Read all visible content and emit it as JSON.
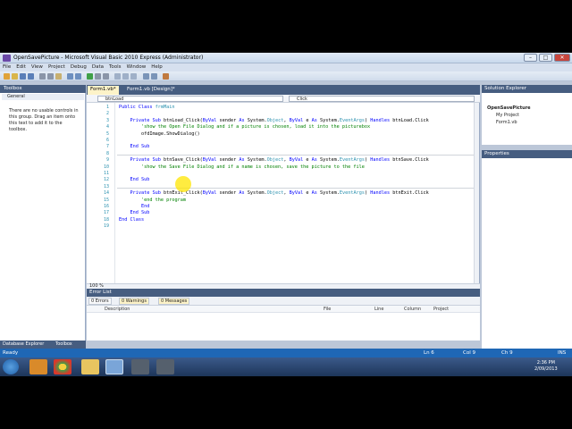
{
  "window": {
    "title": "OpenSavePicture - Microsoft Visual Basic 2010 Express (Administrator)",
    "min": "–",
    "max": "□",
    "close": "✕"
  },
  "menu": [
    "File",
    "Edit",
    "View",
    "Project",
    "Debug",
    "Data",
    "Tools",
    "Window",
    "Help"
  ],
  "toolbox": {
    "title": "Toolbox",
    "group": "General",
    "empty_text": "There are no usable controls in this group. Drag an item onto this text to add it to the toolbox.",
    "tabs": [
      "Database Explorer",
      "Toolbox"
    ]
  },
  "doc_tabs": [
    "Form1.vb*",
    "Form1.vb [Design]*"
  ],
  "navbar": {
    "object": "btnLoad",
    "member": "Click"
  },
  "code_lines": [
    {
      "n": "1",
      "segs": [
        {
          "t": "Public Class ",
          "c": "kw"
        },
        {
          "t": "frmMain",
          "c": "ty"
        }
      ]
    },
    {
      "n": "2",
      "segs": []
    },
    {
      "n": "3",
      "segs": [
        {
          "t": "    Private Sub ",
          "c": "kw"
        },
        {
          "t": "btnLoad_Click(",
          "c": ""
        },
        {
          "t": "ByVal ",
          "c": "kw"
        },
        {
          "t": "sender ",
          "c": ""
        },
        {
          "t": "As ",
          "c": "kw"
        },
        {
          "t": "System.",
          "c": ""
        },
        {
          "t": "Object",
          "c": "ty"
        },
        {
          "t": ", ",
          "c": ""
        },
        {
          "t": "ByVal ",
          "c": "kw"
        },
        {
          "t": "e ",
          "c": ""
        },
        {
          "t": "As ",
          "c": "kw"
        },
        {
          "t": "System.",
          "c": ""
        },
        {
          "t": "EventArgs",
          "c": "ty"
        },
        {
          "t": ") ",
          "c": ""
        },
        {
          "t": "Handles ",
          "c": "kw"
        },
        {
          "t": "btnLoad.Click",
          "c": ""
        }
      ]
    },
    {
      "n": "4",
      "segs": [
        {
          "t": "        'show the Open File Dialog and if a picture is chosen, load it into the picturebox",
          "c": "cm"
        }
      ]
    },
    {
      "n": "5",
      "segs": [
        {
          "t": "        ofdImage.ShowDialog()",
          "c": ""
        }
      ]
    },
    {
      "n": "6",
      "segs": []
    },
    {
      "n": "7",
      "segs": [
        {
          "t": "    End Sub",
          "c": "kw"
        }
      ]
    },
    {
      "n": "8",
      "segs": []
    },
    {
      "n": "9",
      "segs": [
        {
          "t": "    Private Sub ",
          "c": "kw"
        },
        {
          "t": "btnSave_Click(",
          "c": ""
        },
        {
          "t": "ByVal ",
          "c": "kw"
        },
        {
          "t": "sender ",
          "c": ""
        },
        {
          "t": "As ",
          "c": "kw"
        },
        {
          "t": "System.",
          "c": ""
        },
        {
          "t": "Object",
          "c": "ty"
        },
        {
          "t": ", ",
          "c": ""
        },
        {
          "t": "ByVal ",
          "c": "kw"
        },
        {
          "t": "e ",
          "c": ""
        },
        {
          "t": "As ",
          "c": "kw"
        },
        {
          "t": "System.",
          "c": ""
        },
        {
          "t": "EventArgs",
          "c": "ty"
        },
        {
          "t": ") ",
          "c": ""
        },
        {
          "t": "Handles ",
          "c": "kw"
        },
        {
          "t": "btnSave.Click",
          "c": ""
        }
      ]
    },
    {
      "n": "10",
      "segs": [
        {
          "t": "        'show the Save File Dialog and if a name is chosen, save the picture to the file",
          "c": "cm"
        }
      ]
    },
    {
      "n": "11",
      "segs": []
    },
    {
      "n": "12",
      "segs": [
        {
          "t": "    End Sub",
          "c": "kw"
        }
      ]
    },
    {
      "n": "13",
      "segs": []
    },
    {
      "n": "14",
      "segs": [
        {
          "t": "    Private Sub ",
          "c": "kw"
        },
        {
          "t": "btnExit_Click(",
          "c": ""
        },
        {
          "t": "ByVal ",
          "c": "kw"
        },
        {
          "t": "sender ",
          "c": ""
        },
        {
          "t": "As ",
          "c": "kw"
        },
        {
          "t": "System.",
          "c": ""
        },
        {
          "t": "Object",
          "c": "ty"
        },
        {
          "t": ", ",
          "c": ""
        },
        {
          "t": "ByVal ",
          "c": "kw"
        },
        {
          "t": "e ",
          "c": ""
        },
        {
          "t": "As ",
          "c": "kw"
        },
        {
          "t": "System.",
          "c": ""
        },
        {
          "t": "EventArgs",
          "c": "ty"
        },
        {
          "t": ") ",
          "c": ""
        },
        {
          "t": "Handles ",
          "c": "kw"
        },
        {
          "t": "btnExit.Click",
          "c": ""
        }
      ]
    },
    {
      "n": "15",
      "segs": [
        {
          "t": "        'end the program",
          "c": "cm"
        }
      ]
    },
    {
      "n": "16",
      "segs": [
        {
          "t": "        End",
          "c": "kw"
        }
      ]
    },
    {
      "n": "17",
      "segs": [
        {
          "t": "    End Sub",
          "c": "kw"
        }
      ]
    },
    {
      "n": "18",
      "segs": [
        {
          "t": "End Class",
          "c": "kw"
        }
      ]
    },
    {
      "n": "19",
      "segs": []
    }
  ],
  "zoom": "100 %",
  "error_list": {
    "title": "Error List",
    "errors": "0 Errors",
    "warnings": "0 Warnings",
    "messages": "0 Messages",
    "columns": [
      "Description",
      "File",
      "Line",
      "Column",
      "Project"
    ]
  },
  "solution": {
    "title": "Solution Explorer",
    "items": [
      "OpenSavePicture",
      "My Project",
      "Form1.vb"
    ]
  },
  "properties": {
    "title": "Properties"
  },
  "status": {
    "ready": "Ready",
    "ln": "Ln 6",
    "col": "Col 9",
    "ch": "Ch 9",
    "ins": "INS"
  },
  "clock": {
    "time": "2:36 PM",
    "date": "2/09/2013"
  },
  "colors": {
    "accent": "#465d80",
    "status": "#1f67b5",
    "keyword": "#0000ff",
    "comment": "#008000",
    "type": "#2b91af"
  }
}
